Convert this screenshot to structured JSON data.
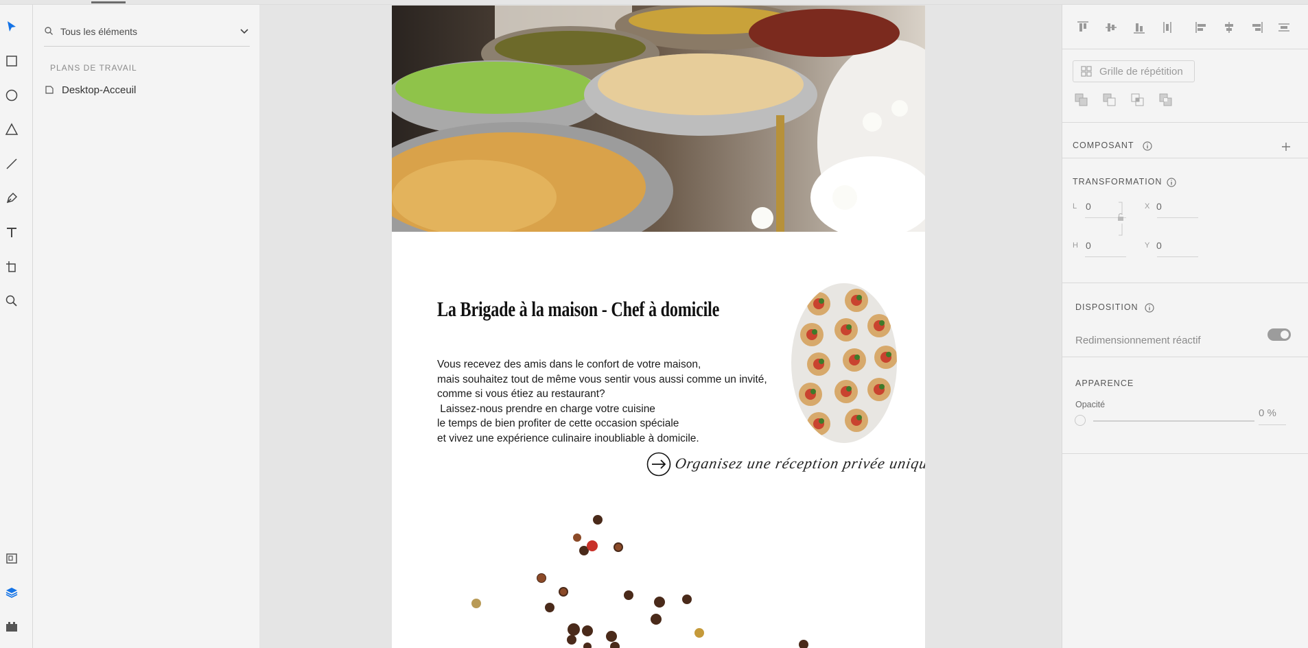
{
  "layers_panel": {
    "search_value": "Tous les éléments",
    "section_title": "PLANS DE TRAVAIL",
    "artboards": [
      "Desktop-Acceuil"
    ]
  },
  "toolbar": {
    "tools": [
      "select-tool",
      "rectangle-tool",
      "ellipse-tool",
      "polygon-tool",
      "line-tool",
      "pen-tool",
      "text-tool",
      "artboard-tool",
      "zoom-tool"
    ],
    "bottom": [
      "assets-panel",
      "layers-panel",
      "plugins-panel"
    ],
    "active_tool": "select-tool",
    "active_bottom": "layers-panel",
    "accent": "#1473e6"
  },
  "canvas": {
    "heading": "La Brigade à la maison - Chef à domicile",
    "paragraph": "Vous recevez des amis dans le confort de votre maison,\nmais souhaitez tout de même vous sentir vous aussi comme un invité,\ncomme si vous étiez au restaurant?\n Laissez-nous prendre en charge votre cuisine\nle temps de bien profiter de cette occasion spéciale\net vivez une expérience culinaire inoubliable à domicile.",
    "cta_text": "Organisez une réception privée unique"
  },
  "properties": {
    "repeat_grid_label": "Grille de répétition",
    "component_label": "COMPOSANT",
    "transform_label": "TRANSFORMATION",
    "fields": {
      "w_label": "L",
      "w_value": "0",
      "x_label": "X",
      "x_value": "0",
      "h_label": "H",
      "h_value": "0",
      "y_label": "Y",
      "y_value": "0"
    },
    "layout_label": "DISPOSITION",
    "responsive_label": "Redimensionnement réactif",
    "responsive_on": true,
    "appearance_label": "APPARENCE",
    "opacity_label": "Opacité",
    "opacity_value": "0 %"
  }
}
